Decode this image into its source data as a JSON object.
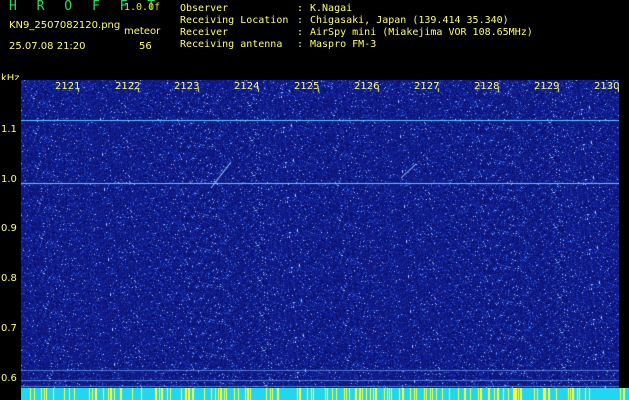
{
  "header": {
    "app_title": "H R O F F T",
    "version": "1.0.0f",
    "filename": "KN9_2507082120.png",
    "mode": "meteor",
    "datetime": "25.07.08 21:20",
    "count": "56",
    "info": [
      {
        "label": "Observer",
        "value": "K.Nagai"
      },
      {
        "label": "Receiving Location",
        "value": "Chigasaki, Japan (139.414 35.340)"
      },
      {
        "label": "Receiver",
        "value": "AirSpy mini (Miakejima VOR 108.65MHz)"
      },
      {
        "label": "Receiving antenna",
        "value": "Maspro FM-3"
      }
    ],
    "separator": ":"
  },
  "axis": {
    "unit": "kHz",
    "y_ticks": [
      "1.1",
      "1.0",
      "0.9",
      "0.8",
      "0.7",
      "0.6"
    ],
    "x_ticks": [
      "2121",
      "2122",
      "2123",
      "2124",
      "2125",
      "2126",
      "2127",
      "2128",
      "2129",
      "2130"
    ]
  },
  "colors": {
    "background": "#101a8a",
    "signal_line": "#4fd0ff",
    "label": "#ffff66",
    "title": "#20e060",
    "bottom_band": "#22d6ef"
  }
}
